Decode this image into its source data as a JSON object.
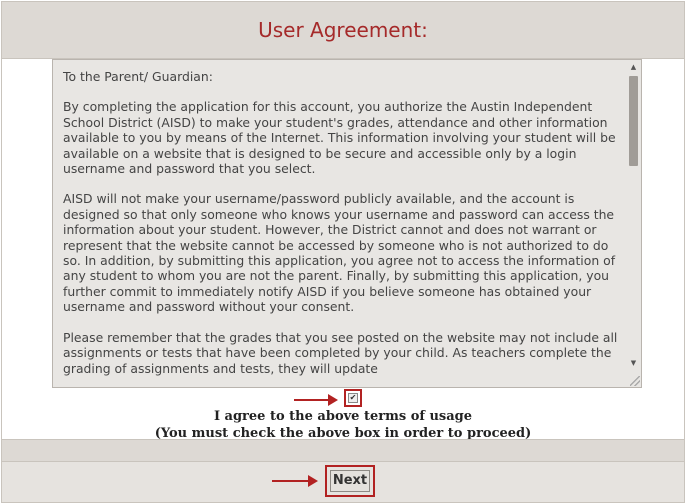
{
  "header": {
    "title": "User Agreement:"
  },
  "agreement": {
    "paragraphs": [
      "To the Parent/ Guardian:",
      "By completing the application for this account, you authorize the Austin Independent School District (AISD) to make your student's grades, attendance and other information available to you by means of the Internet. This information involving your student will be available on a website that is designed to be secure and accessible only by a login username and password that you select.",
      "AISD will not make your username/password publicly available, and the account is designed so that only someone who knows your username and password can access the information about your student.  However, the District cannot and does not warrant or represent that the website cannot be accessed by someone who is not authorized to do so. In addition, by submitting this application, you agree not to access the information of any student to whom you are not the parent.  Finally, by submitting this application, you further commit to immediately notify AISD if you believe someone has obtained your username and password without your consent.",
      "Please remember that the grades that you see posted on the website may not include all assignments or tests that have been completed by your child.  As teachers complete the grading of assignments and tests, they will update"
    ]
  },
  "terms": {
    "checkbox_checked": true,
    "agree_label": "I agree to the above terms of usage",
    "must_check_label": "(You must check the above box in order to proceed)"
  },
  "actions": {
    "next_label": "Next"
  },
  "colors": {
    "accent": "#b22222",
    "title": "#a52a2a"
  }
}
